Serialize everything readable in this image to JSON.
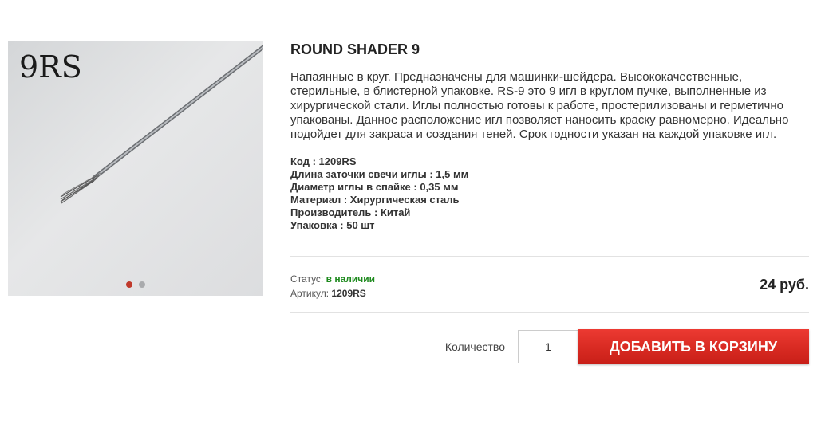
{
  "product": {
    "image_label": "9RS",
    "title": "ROUND SHADER 9",
    "description": "Напаянные в круг. Предназначены для машинки-шейдера. Высококачественные, стерильные, в блистерной упаковке. RS-9 это 9 игл в круглом пучке, выполненные из хирургической стали. Иглы полностью готовы к работе, простерилизованы и герметично упакованы. Данное расположение игл позволяет наносить краску равномерно. Идеально подойдет для закраса и создания теней. Срок годности указан на каждой упаковке игл.",
    "specs": [
      "Код : 1209RS",
      "Длина заточки свечи иглы : 1,5 мм",
      "Диаметр иглы в спайке : 0,35 мм",
      "Материал : Хирургическая сталь",
      "Производитель : Китай",
      "Упаковка : 50 шт"
    ]
  },
  "meta": {
    "status_label": "Статус:",
    "status_value": "в наличии",
    "article_label": "Артикул:",
    "article_value": "1209RS"
  },
  "price": "24 руб.",
  "cart": {
    "quantity_label": "Количество",
    "quantity_value": "1",
    "add_button_label": "ДОБАВИТЬ В КОРЗИНУ"
  },
  "gallery": {
    "slide_count": 2,
    "active_slide": 1
  },
  "colors": {
    "accent": "#d82a22",
    "status_green": "#1e8a1e"
  }
}
